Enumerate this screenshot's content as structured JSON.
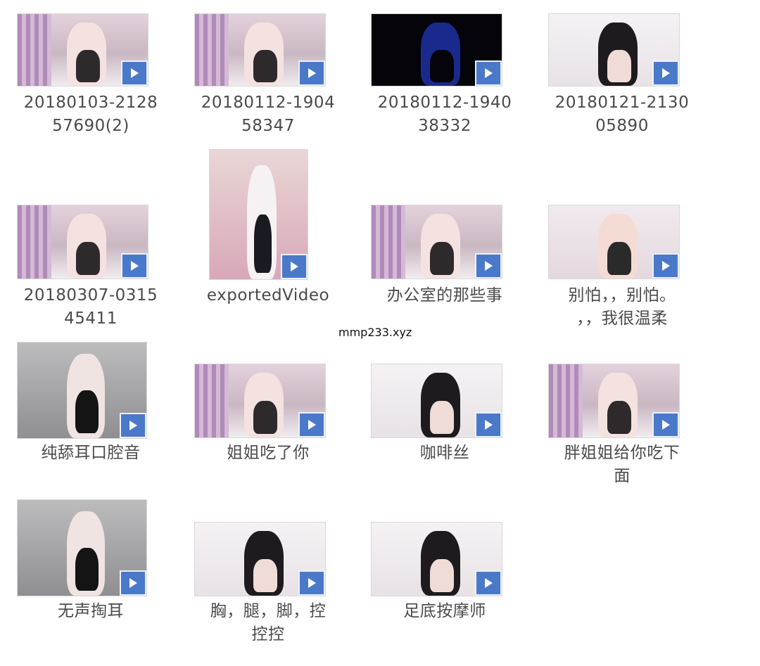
{
  "files": [
    {
      "name": "20180103-212857690(2)",
      "label_lines": "20180103-2128\n57690(2)",
      "thumb": "pink",
      "type_icon": "play-icon"
    },
    {
      "name": "20180112-190458347",
      "label_lines": "20180112-1904\n58347",
      "thumb": "pink",
      "type_icon": "play-icon"
    },
    {
      "name": "20180112-194038332",
      "label_lines": "20180112-1940\n38332",
      "thumb": "black",
      "type_icon": "play-icon"
    },
    {
      "name": "20180121-213005890",
      "label_lines": "20180121-2130\n05890",
      "thumb": "white",
      "type_icon": "play-icon"
    },
    {
      "name": "20180307-031545411",
      "label_lines": "20180307-0315\n45411",
      "thumb": "pink",
      "type_icon": "play-icon"
    },
    {
      "name": "exportedVideo",
      "label_lines": "exportedVideo",
      "thumb": "portrait",
      "type_icon": "play-icon"
    },
    {
      "name": "办公室的那些事",
      "label_lines": "办公室的那些事",
      "thumb": "pink",
      "type_icon": "play-icon"
    },
    {
      "name": "别怕，，别怕。，，我很温柔",
      "label_lines": "别怕，，别怕。\n，，我很温柔",
      "thumb": "room",
      "type_icon": "play-icon"
    },
    {
      "name": "纯舔耳口腔音",
      "label_lines": "纯舔耳口腔音",
      "thumb": "grey",
      "type_icon": "play-icon"
    },
    {
      "name": "姐姐吃了你",
      "label_lines": "姐姐吃了你",
      "thumb": "pink",
      "type_icon": "play-icon"
    },
    {
      "name": "咖啡丝",
      "label_lines": "咖啡丝",
      "thumb": "white",
      "type_icon": "play-icon"
    },
    {
      "name": "胖姐姐给你吃下面",
      "label_lines": "胖姐姐给你吃下\n面",
      "thumb": "pink",
      "type_icon": "play-icon"
    },
    {
      "name": "无声掏耳",
      "label_lines": "无声掏耳",
      "thumb": "grey",
      "type_icon": "play-icon"
    },
    {
      "name": "胸，腿，脚，控控控",
      "label_lines": "胸，腿，脚，控\n控控",
      "thumb": "white",
      "type_icon": "play-icon"
    },
    {
      "name": "足底按摩师",
      "label_lines": "足底按摩师",
      "thumb": "white",
      "type_icon": "play-icon"
    }
  ],
  "watermark": "mmp233.xyz",
  "colors": {
    "play_badge": "#4b79c9",
    "label_text": "#4a4a4a"
  }
}
